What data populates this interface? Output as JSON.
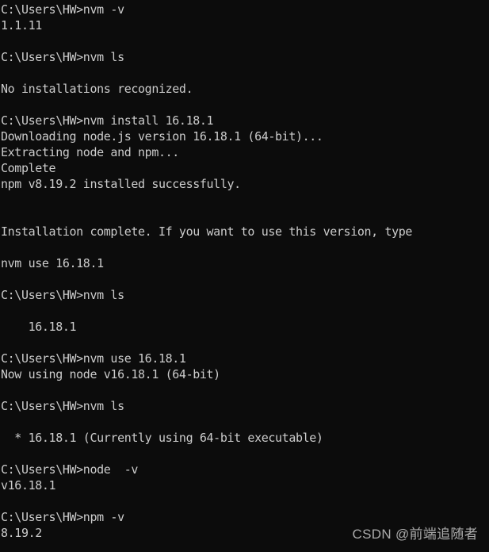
{
  "terminal": {
    "app": "Windows Command Prompt",
    "background_color": "#0c0c0c",
    "text_color": "#cccccc",
    "prompt": "C:\\Users\\HW>",
    "columns": 60,
    "lines": [
      "C:\\Users\\HW>nvm -v",
      "1.1.11",
      "",
      "C:\\Users\\HW>nvm ls",
      "",
      "No installations recognized.",
      "",
      "C:\\Users\\HW>nvm install 16.18.1",
      "Downloading node.js version 16.18.1 (64-bit)...",
      "Extracting node and npm...",
      "Complete",
      "npm v8.19.2 installed successfully.",
      "",
      "",
      "Installation complete. If you want to use this version, type",
      "",
      "nvm use 16.18.1",
      "",
      "C:\\Users\\HW>nvm ls",
      "",
      "    16.18.1",
      "",
      "C:\\Users\\HW>nvm use 16.18.1",
      "Now using node v16.18.1 (64-bit)",
      "",
      "C:\\Users\\HW>nvm ls",
      "",
      "  * 16.18.1 (Currently using 64-bit executable)",
      "",
      "C:\\Users\\HW>node  -v",
      "v16.18.1",
      "",
      "C:\\Users\\HW>npm -v",
      "8.19.2"
    ]
  },
  "watermark": {
    "text": "CSDN @前端追随者",
    "color": "#b9b9b9"
  }
}
